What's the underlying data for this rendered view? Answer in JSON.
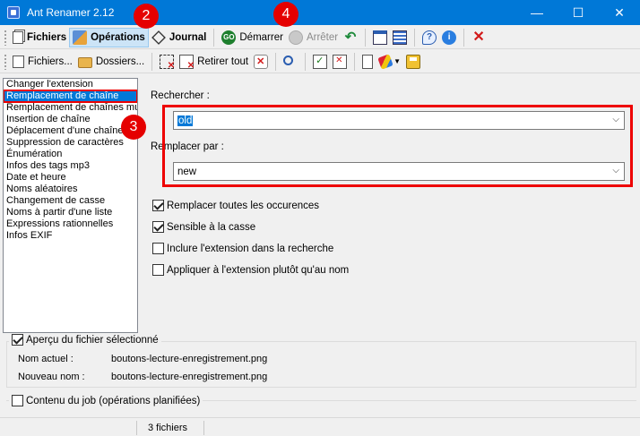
{
  "window": {
    "title": "Ant Renamer 2.12",
    "minimize_glyph": "—",
    "maximize_glyph": "☐",
    "close_glyph": "✕"
  },
  "toolbar1": {
    "fichiers_label": "Fichiers",
    "operations_label": "Opérations",
    "journal_label": "Journal",
    "demarrer_label": "Démarrer",
    "arreter_label": "Arrêter"
  },
  "toolbar2": {
    "fichiers_label": "Fichiers...",
    "dossiers_label": "Dossiers...",
    "retirer_tout_label": "Retirer tout"
  },
  "operations_list": {
    "items": [
      {
        "label": "Changer l'extension"
      },
      {
        "label": "Remplacement de chaîne"
      },
      {
        "label": "Remplacement de chaînes mul"
      },
      {
        "label": "Insertion de chaîne"
      },
      {
        "label": "Déplacement d'une chaîne"
      },
      {
        "label": "Suppression de caractères"
      },
      {
        "label": "Énumération"
      },
      {
        "label": "Infos des tags mp3"
      },
      {
        "label": "Date et heure"
      },
      {
        "label": "Noms aléatoires"
      },
      {
        "label": "Changement de casse"
      },
      {
        "label": "Noms à partir d'une liste"
      },
      {
        "label": "Expressions rationnelles"
      },
      {
        "label": "Infos EXIF"
      }
    ],
    "selected_index": 1
  },
  "form": {
    "rechercher_label": "Rechercher :",
    "rechercher_value": "old",
    "remplacer_label": "Remplacer par :",
    "remplacer_value": "new",
    "options": [
      {
        "label": "Remplacer toutes les occurences",
        "checked": true
      },
      {
        "label": "Sensible à la casse",
        "checked": true
      },
      {
        "label": "Inclure l'extension dans la recherche",
        "checked": false
      },
      {
        "label": "Appliquer à l'extension plutôt qu'au nom",
        "checked": false
      }
    ]
  },
  "preview": {
    "title": "Aperçu du fichier sélectionné",
    "checked": true,
    "current_name_label": "Nom actuel :",
    "current_name_value": "boutons-lecture-enregistrement.png",
    "new_name_label": "Nouveau nom :",
    "new_name_value": "boutons-lecture-enregistrement.png"
  },
  "job": {
    "title": "Contenu du job (opérations planifiées)",
    "checked": false
  },
  "status": {
    "file_count": "3 fichiers"
  },
  "annotations": {
    "badge_2": "2",
    "badge_3": "3",
    "badge_4": "4"
  },
  "colors": {
    "titlebar": "#0078d7",
    "selection": "#0078d7",
    "annotation_red": "#e50000"
  }
}
